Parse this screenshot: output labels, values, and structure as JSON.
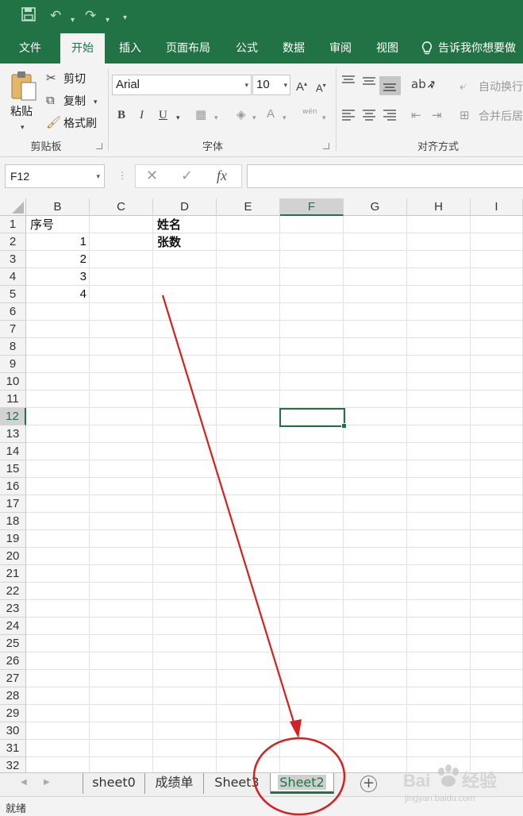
{
  "ribbon": {
    "tabs": [
      "文件",
      "开始",
      "插入",
      "页面布局",
      "公式",
      "数据",
      "审阅",
      "视图"
    ],
    "active_tab": "开始",
    "tell_me": "告诉我你想要做",
    "clipboard": {
      "paste": "粘贴",
      "cut": "剪切",
      "copy": "复制",
      "format_painter": "格式刷",
      "label": "剪贴板"
    },
    "font": {
      "name": "Arial",
      "size": "10",
      "bold": "B",
      "italic": "I",
      "underline": "U",
      "label": "字体",
      "wen": "wén"
    },
    "alignment": {
      "wrap_text": "自动换行",
      "merge": "合并后居",
      "label": "对齐方式"
    }
  },
  "formula_bar": {
    "name_box": "F12",
    "fx": "fx",
    "value": ""
  },
  "grid": {
    "columns": [
      "B",
      "C",
      "D",
      "E",
      "F",
      "G",
      "H",
      "I"
    ],
    "selected_column": "F",
    "rows": [
      "1",
      "2",
      "3",
      "4",
      "5",
      "6",
      "7",
      "8",
      "9",
      "10",
      "11",
      "12",
      "13",
      "14",
      "15",
      "16",
      "17",
      "18",
      "19",
      "20",
      "21",
      "22",
      "23",
      "24",
      "25",
      "26",
      "27",
      "28",
      "29",
      "30",
      "31",
      "32"
    ],
    "selected_row": "12",
    "cells": {
      "B1": "序号",
      "B2": "1",
      "B3": "2",
      "B4": "3",
      "B5": "4",
      "D1": "姓名",
      "D2": "张数"
    }
  },
  "sheets": {
    "tabs": [
      "sheet0",
      "成绩单",
      "Sheet3",
      "Sheet2"
    ],
    "active": "Sheet2"
  },
  "status": {
    "ready": "就绪"
  },
  "watermark": {
    "brand": "Baidu 经验",
    "url": "jingyan.baidu.com"
  },
  "colors": {
    "excel_green": "#217346",
    "annotation_red": "#d42020"
  }
}
